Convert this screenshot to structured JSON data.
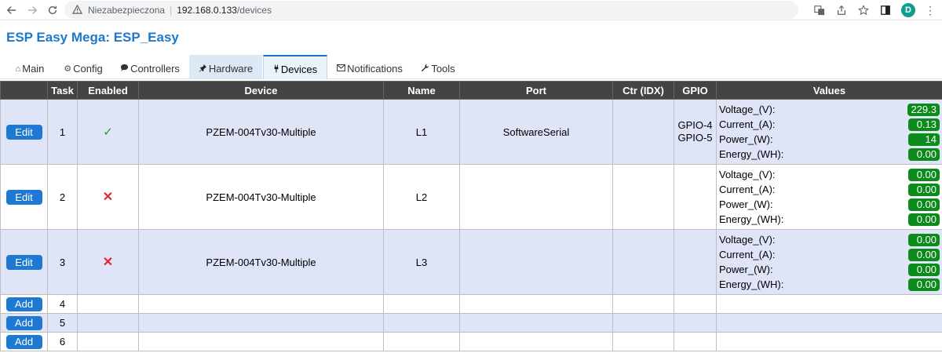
{
  "browser": {
    "security_label": "Niezabezpieczona",
    "url_host": "192.168.0.133",
    "url_path": "/devices",
    "profile_initial": "D"
  },
  "page": {
    "title": "ESP Easy Mega: ESP_Easy"
  },
  "menu": {
    "main": "Main",
    "config": "Config",
    "controllers": "Controllers",
    "hardware": "Hardware",
    "devices": "Devices",
    "notifications": "Notifications",
    "tools": "Tools"
  },
  "table": {
    "headers": [
      "",
      "Task",
      "Enabled",
      "Device",
      "Name",
      "Port",
      "Ctr (IDX)",
      "GPIO",
      "Values"
    ],
    "rows": [
      {
        "button": "Edit",
        "task": "1",
        "enabled": "✓",
        "device": "PZEM-004Tv30-Multiple",
        "name": "L1",
        "port": "SoftwareSerial",
        "ctr": "",
        "gpio1": "GPIO-4",
        "gpio2": "GPIO-5",
        "v1_label": "Voltage_(V):",
        "v1": "229.3",
        "v2_label": "Current_(A):",
        "v2": "0.13",
        "v3_label": "Power_(W):",
        "v3": "14",
        "v4_label": "Energy_(WH):",
        "v4": "0.00"
      },
      {
        "button": "Edit",
        "task": "2",
        "enabled": "✕",
        "device": "PZEM-004Tv30-Multiple",
        "name": "L2",
        "port": "",
        "ctr": "",
        "gpio1": "",
        "gpio2": "",
        "v1_label": "Voltage_(V):",
        "v1": "0.00",
        "v2_label": "Current_(A):",
        "v2": "0.00",
        "v3_label": "Power_(W):",
        "v3": "0.00",
        "v4_label": "Energy_(WH):",
        "v4": "0.00"
      },
      {
        "button": "Edit",
        "task": "3",
        "enabled": "✕",
        "device": "PZEM-004Tv30-Multiple",
        "name": "L3",
        "port": "",
        "ctr": "",
        "gpio1": "",
        "gpio2": "",
        "v1_label": "Voltage_(V):",
        "v1": "0.00",
        "v2_label": "Current_(A):",
        "v2": "0.00",
        "v3_label": "Power_(W):",
        "v3": "0.00",
        "v4_label": "Energy_(WH):",
        "v4": "0.00"
      },
      {
        "button": "Add",
        "task": "4"
      },
      {
        "button": "Add",
        "task": "5"
      },
      {
        "button": "Add",
        "task": "6"
      }
    ]
  },
  "colors": {
    "accent_blue": "#1f78d1",
    "value_badge_green": "#0c8b1d",
    "enabled_check": "#28963a",
    "disabled_cross": "#e0262f"
  }
}
